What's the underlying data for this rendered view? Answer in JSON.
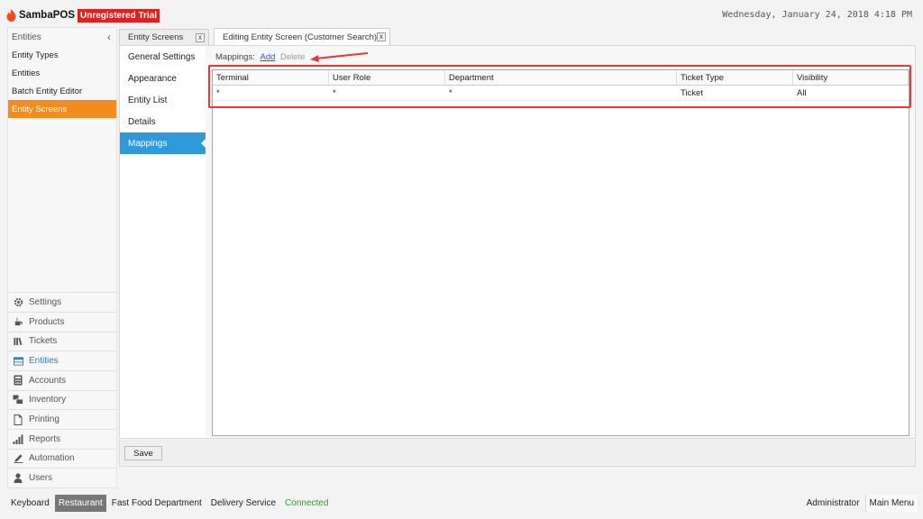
{
  "header": {
    "brand": "SambaPOS",
    "trial_badge": "Unregistered Trial",
    "datetime": "Wednesday, January 24, 2018 4:18 PM",
    "brand_color": "#e01f1f"
  },
  "left_nav": {
    "title": "Entities",
    "collapse_glyph": "‹",
    "items": [
      {
        "label": "Entity Types"
      },
      {
        "label": "Entities"
      },
      {
        "label": "Batch Entity Editor"
      },
      {
        "label": "Entity Screens",
        "active": true
      }
    ],
    "active_color": "#f28c1e"
  },
  "modules": [
    {
      "label": "Settings",
      "icon": "gear-icon"
    },
    {
      "label": "Products",
      "icon": "coffee-icon"
    },
    {
      "label": "Tickets",
      "icon": "books-icon"
    },
    {
      "label": "Entities",
      "icon": "table-icon",
      "selected": true
    },
    {
      "label": "Accounts",
      "icon": "calculator-icon"
    },
    {
      "label": "Inventory",
      "icon": "boxes-icon"
    },
    {
      "label": "Printing",
      "icon": "document-icon"
    },
    {
      "label": "Reports",
      "icon": "bar-chart-icon"
    },
    {
      "label": "Automation",
      "icon": "pencil-icon"
    },
    {
      "label": "Users",
      "icon": "user-icon"
    }
  ],
  "tabs": [
    {
      "label": "Entity Screens",
      "close": "x"
    },
    {
      "label": "Editing Entity Screen (Customer Search)",
      "close": "x",
      "active": true
    }
  ],
  "settings_nav": {
    "items": [
      {
        "label": "General Settings"
      },
      {
        "label": "Appearance"
      },
      {
        "label": "Entity List"
      },
      {
        "label": "Details"
      },
      {
        "label": "Mappings",
        "active": true
      }
    ]
  },
  "mappings": {
    "label": "Mappings:",
    "add": "Add",
    "delete": "Delete",
    "columns": [
      "Terminal",
      "User Role",
      "Department",
      "Ticket Type",
      "Visibility"
    ],
    "rows": [
      [
        "*",
        "*",
        "*",
        "Ticket",
        "All"
      ]
    ]
  },
  "actions": {
    "save": "Save"
  },
  "statusbar": {
    "keyboard": "Keyboard",
    "restaurant": "Restaurant",
    "department": "Fast Food Department",
    "delivery": "Delivery Service",
    "connection": "Connected",
    "user": "Administrator",
    "main_menu": "Main Menu"
  }
}
